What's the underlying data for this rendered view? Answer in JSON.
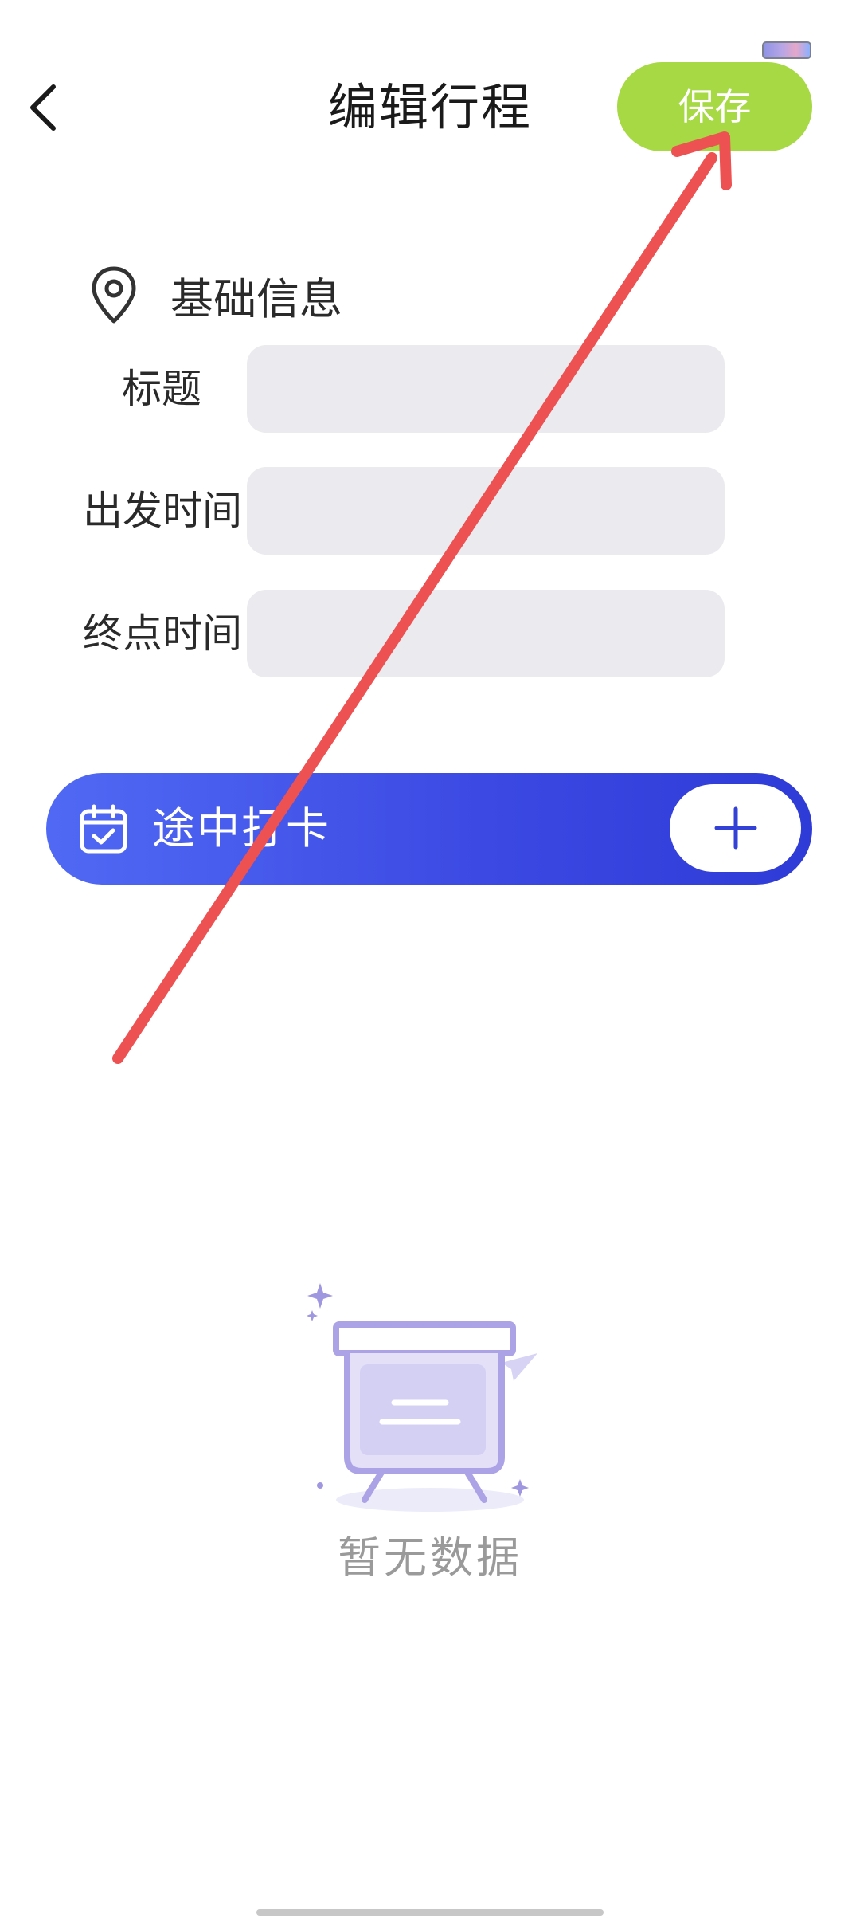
{
  "header": {
    "title": "编辑行程",
    "save_label": "保存",
    "back_icon": "chevron-left-icon"
  },
  "basic_info": {
    "title": "基础信息",
    "icon": "location-pin-icon",
    "fields": [
      {
        "label": "标题",
        "value": "",
        "placeholder": ""
      },
      {
        "label": "出发时间",
        "value": "",
        "placeholder": ""
      },
      {
        "label": "终点时间",
        "value": "",
        "placeholder": ""
      }
    ]
  },
  "checkin": {
    "title": "途中打卡",
    "icon": "calendar-check-icon",
    "add_icon": "plus-icon"
  },
  "empty_state": {
    "text": "暂无数据",
    "icon": "empty-easel-icon"
  },
  "colors": {
    "save_button": "#a6d944",
    "checkin_bar_start": "#5069f4",
    "checkin_bar_end": "#2f3bd6",
    "input_bg": "#ebebef",
    "annotation_arrow": "#ee5151"
  }
}
